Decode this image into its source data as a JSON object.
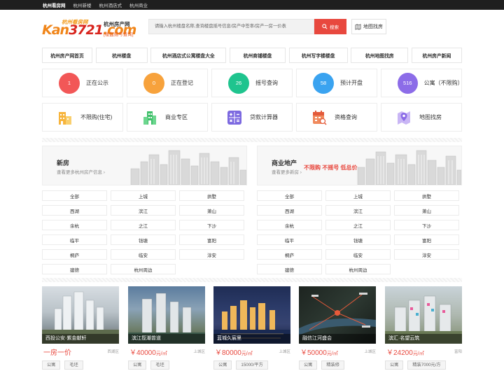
{
  "topbar": {
    "links": [
      "杭州看房网",
      "杭州新楼",
      "杭州酒店式",
      "杭州商业"
    ]
  },
  "logo": {
    "top": "杭州看房网",
    "main_a": "Kan",
    "main_b": "3721",
    "main_c": ".com"
  },
  "site": {
    "name": "杭州房产网",
    "sub": "[楼盘摇号查询]"
  },
  "search": {
    "placeholder": "请输入杭州楼盘名称,查询楼盘摇号信息/房产中签率/房产一房一价表",
    "button": "搜索",
    "map_button": "地图找房"
  },
  "nav": [
    "杭州房产网首页",
    "杭州楼盘",
    "杭州酒店式公寓楼盘大全",
    "杭州商铺楼盘",
    "杭州写字楼楼盘",
    "杭州地图找房",
    "杭州房产新闻"
  ],
  "stats": [
    {
      "value": "1",
      "label": "正在公示",
      "color": "#f25757"
    },
    {
      "value": "0",
      "label": "正在登记",
      "color": "#f7a23c"
    },
    {
      "value": "26",
      "label": "摇号查询",
      "color": "#1fc48e"
    },
    {
      "value": "58",
      "label": "预计开盘",
      "color": "#3aa3f0"
    },
    {
      "value": "516",
      "label": "公寓（不限购）",
      "color": "#8c6ce8"
    }
  ],
  "features": [
    {
      "label": "不限购(住宅)",
      "icon": "building-icon"
    },
    {
      "label": "商业专区",
      "icon": "commercial-icon"
    },
    {
      "label": "贷款计算器",
      "icon": "calculator-icon"
    },
    {
      "label": "资格查询",
      "icon": "calendar-search-icon"
    },
    {
      "label": "地图找房",
      "icon": "map-pin-icon"
    }
  ],
  "new_house": {
    "title": "新房",
    "subtitle": "查看更多杭州房产信息 ›",
    "districts": [
      "全部",
      "上城",
      "拱墅",
      "西湖",
      "滨江",
      "萧山",
      "余杭",
      "之江",
      "下沙",
      "临平",
      "钱塘",
      "富阳",
      "桐庐",
      "临安",
      "淳安",
      "建德",
      "杭州周边"
    ]
  },
  "commercial": {
    "title": "商业地产",
    "subtitle": "查看更多新房 ›",
    "tagline": "不限购 不摇号 低总价",
    "districts": [
      "全部",
      "上城",
      "拱墅",
      "西湖",
      "滨江",
      "萧山",
      "余杭",
      "之江",
      "下沙",
      "临平",
      "钱塘",
      "富阳",
      "桐庐",
      "临安",
      "淳安",
      "建德",
      "杭州周边"
    ]
  },
  "listings": [
    {
      "caption": "西投公安·紫金献轩",
      "price": "一房一价",
      "unit": "",
      "area": "西湖区",
      "tags": [
        "公寓",
        "毛坯"
      ]
    },
    {
      "caption": "滨江揽潮曾道",
      "price": "￥40000",
      "unit": "元/㎡",
      "area": "上城区",
      "tags": [
        "公寓",
        "毛坯"
      ]
    },
    {
      "caption": "蓝城久宸里",
      "price": "￥80000",
      "unit": "元/㎡",
      "area": "上城区",
      "tags": [
        "公寓",
        "15000/平方"
      ]
    },
    {
      "caption": "融信江河盛会",
      "price": "￥50000",
      "unit": "元/㎡",
      "area": "上城区",
      "tags": [
        "公寓",
        "精装修"
      ]
    },
    {
      "caption": "滨汇·名望云筑",
      "price": "￥24200",
      "unit": "元/㎡",
      "area": "富阳",
      "tags": [
        "公寓",
        "精装7000元/方"
      ]
    }
  ]
}
